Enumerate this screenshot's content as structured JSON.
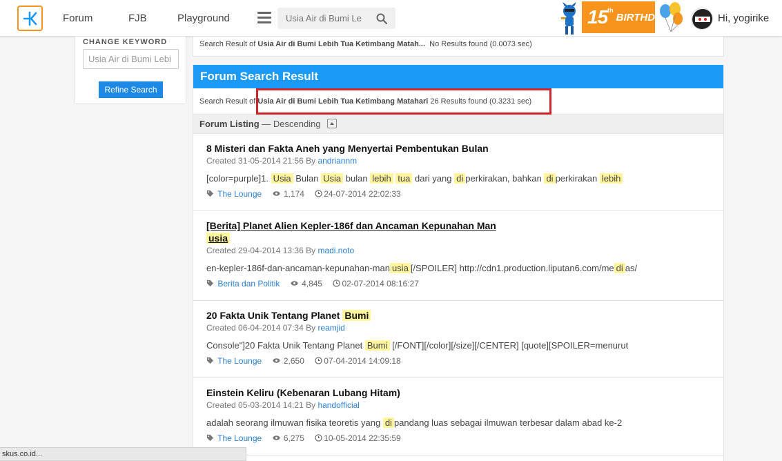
{
  "header": {
    "nav": [
      "Forum",
      "FJB",
      "Playground"
    ],
    "search_placeholder": "Usia Air di Bumi Le",
    "birthday_num": "15",
    "birthday_sup": "th",
    "birthday_text": "BIRTHDAY",
    "greeting": "Hi, yogirike",
    "accent": "#f7941d"
  },
  "sidebar": {
    "label": "CHANGE KEYWORD",
    "input_value": "Usia Air di Bumi Lebi",
    "refine_label": "Refine Search"
  },
  "top_result": {
    "prefix": "Search Result of",
    "query": "Usia Air di Bumi Lebih Tua Ketimbang Matah...",
    "status": "No Results found (0.0073 sec)"
  },
  "forum": {
    "title": "Forum Search Result",
    "result_prefix": "Search Result of",
    "result_query": "Usia Air di Bumi Lebih Tua Ketimbang Matahari",
    "result_status": "26 Results found (0.3231 sec)",
    "listing_label": "Forum Listing",
    "listing_sort": "— Descending"
  },
  "items": [
    {
      "title": "8 Misteri dan Fakta Aneh yang Menyertai Pembentukan Bulan",
      "created": "Created 31-05-2014 21:56 By",
      "author": "andriannm",
      "category": "The Lounge",
      "views": "1,174",
      "date": "24-07-2014 22:02:33"
    },
    {
      "title": "[Berita] Planet Alien Kepler-186f dan Ancaman Kepunahan Man",
      "title_hl": "usia",
      "created": "Created 29-04-2014 13:36 By",
      "author": "madi.noto",
      "category": "Berita dan Politik",
      "views": "4,845",
      "date": "02-07-2014 08:16:27"
    },
    {
      "title": "20 Fakta Unik Tentang Planet",
      "title_hl": "Bumi",
      "created": "Created 06-04-2014 07:34 By",
      "author": "reamjid",
      "category": "The Lounge",
      "views": "2,650",
      "date": "07-04-2014 14:09:18"
    },
    {
      "title": "Einstein Keliru (Kebenaran Lubang Hitam)",
      "created": "Created 05-03-2014 14:21 By",
      "author": "handofficial",
      "category": "The Lounge",
      "views": "6,275",
      "date": "10-05-2014 22:35:59"
    }
  ],
  "snippets": {
    "s1": [
      "[color=purple]1.",
      "Usia",
      "Bulan",
      "Usia",
      "bulan",
      "lebih",
      "tua",
      "dari yang",
      "di",
      "perkirakan, bahkan",
      "di",
      "perkirakan",
      "lebih"
    ],
    "s2": [
      "en-kepler-186f-dan-ancaman-kepunahan-man",
      "usia",
      "[/SPOILER] http://cdn1.production.liputan6.com/me",
      "di",
      "as/"
    ],
    "s3": [
      "Console\"]20 Fakta Unik Tentang Planet",
      "Bumi",
      "[/FONT][/color][/size][/CENTER] [quote][SPOILER=menurut"
    ],
    "s4": [
      "adalah seorang ilmuwan fisika teoretis yang",
      "di",
      "pandang luas sebagai ilmuwan terbesar dalam abad ke-2"
    ]
  },
  "statusbar": "skus.co.id..."
}
